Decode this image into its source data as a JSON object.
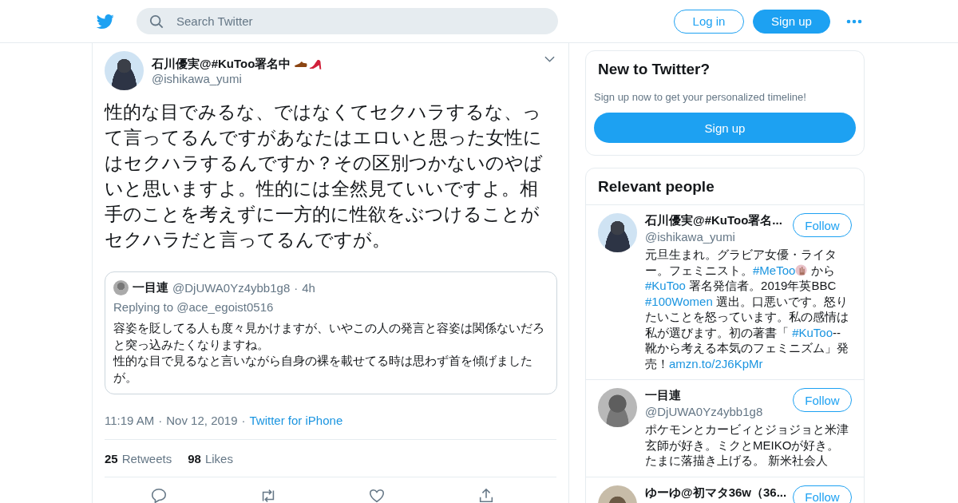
{
  "header": {
    "search": {
      "placeholder": "Search Twitter"
    },
    "buttons": [
      {
        "label": "Log in",
        "kind": "outline"
      },
      {
        "label": "Sign up",
        "kind": "filled"
      }
    ]
  },
  "tweet": {
    "author": {
      "name": "石川優実@#KuToo署名中",
      "handle": "@ishikawa_yumi"
    },
    "text": "性的な目でみるな、ではなくてセクハラするな、って言ってるんですがあなたはエロいと思った女性にはセクハラするんですか？その区別つかないのやばいと思いますよ。性的には全然見ていいですよ。相手のことを考えずに一方的に性欲をぶつけることがセクハラだと言ってるんですが。",
    "quote": {
      "name": "一目連",
      "handle": "@DjUWA0Yz4ybb1g8",
      "separator": "·",
      "time": "4h",
      "replying_to": "Replying to @ace_egoist0516",
      "paragraphs": [
        "容姿を貶してる人も度々見かけますが、いやこの人の発言と容姿は関係ないだろと突っ込みたくなりますね。",
        "性的な目で見るなと言いながら自身の裸を載せてる時は思わず首を傾げましたが。"
      ]
    },
    "time": "11:19 AM",
    "separator_1": "·",
    "date": "Nov 12, 2019",
    "separator_2": "·",
    "source": "Twitter for iPhone",
    "stats": [
      {
        "count": "25",
        "label": "Retweets"
      },
      {
        "count": "98",
        "label": "Likes"
      }
    ]
  },
  "sidebar": {
    "signup_card": {
      "title": "New to Twitter?",
      "text": "Sign up now to get your personalized timeline!",
      "button": "Sign up"
    },
    "relevant_people": {
      "title": "Relevant people",
      "people": [
        {
          "name": "石川優実@#KuToo署名...",
          "handle": "@ishikawa_yumi",
          "follow": "Follow",
          "bio": [
            {
              "kind": "text",
              "text": "元旦生まれ。グラビア女優・ライター。フェミニスト。"
            },
            {
              "kind": "link",
              "text": "#MeToo"
            },
            {
              "kind": "emoji"
            },
            {
              "kind": "text",
              "text": " から "
            },
            {
              "kind": "link",
              "text": "#KuToo"
            },
            {
              "kind": "text",
              "text": " 署名発信者。2019年英BBC "
            },
            {
              "kind": "link",
              "text": "#100Women"
            },
            {
              "kind": "text",
              "text": " 選出。口悪いです。怒りたいことを怒っています。私の感情は私が選びます。初の著書「 "
            },
            {
              "kind": "link",
              "text": "#KuToo"
            },
            {
              "kind": "text",
              "text": "--靴から考える本気のフェミニズム」発売！"
            },
            {
              "kind": "link",
              "text": "amzn.to/2J6KpMr"
            }
          ]
        },
        {
          "name": "一目連",
          "handle": "@DjUWA0Yz4ybb1g8",
          "follow": "Follow",
          "bio": [
            {
              "kind": "text",
              "text": "ポケモンとカービィとジョジョと米津玄師が好き。ミクとMEIKOが好き。たまに落描き上げる。 新米社会人"
            }
          ]
        },
        {
          "name": "ゆーゆ@初マタ36w（36...",
          "follow": "Follow"
        }
      ]
    }
  }
}
